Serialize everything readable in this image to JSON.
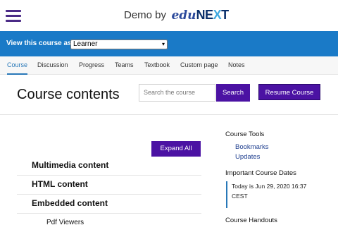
{
  "header": {
    "brand_prefix": "Demo by",
    "brand_edu": "edu",
    "brand_ne": "NE",
    "brand_x": "X",
    "brand_t": "T"
  },
  "view_bar": {
    "label": "View this course as:",
    "selected_option": "Learner"
  },
  "tabs": [
    {
      "label": "Course",
      "active": true
    },
    {
      "label": "Discussion"
    },
    {
      "label": "Progress"
    },
    {
      "label": "Teams"
    },
    {
      "label": "Textbook"
    },
    {
      "label": "Custom page"
    },
    {
      "label": "Notes"
    }
  ],
  "main": {
    "title": "Course contents",
    "search_placeholder": "Search the course",
    "search_button": "Search",
    "resume_button": "Resume Course",
    "expand_button": "Expand All",
    "outline": [
      {
        "label": "Multimedia content"
      },
      {
        "label": "HTML content"
      },
      {
        "label": "Embedded content"
      }
    ],
    "outline_sub": [
      {
        "label": "Pdf Viewers"
      }
    ]
  },
  "sidebar": {
    "tools_heading": "Course Tools",
    "tools": [
      {
        "label": "Bookmarks"
      },
      {
        "label": "Updates"
      }
    ],
    "dates_heading": "Important Course Dates",
    "today_text": "Today is Jun 29, 2020 16:37 CEST",
    "handouts_heading": "Course Handouts"
  },
  "colors": {
    "accent_purple": "#4b12a3",
    "view_bar_blue": "#1a7ac7",
    "active_tab_blue": "#2878b8",
    "link_blue": "#1f3f8f"
  }
}
